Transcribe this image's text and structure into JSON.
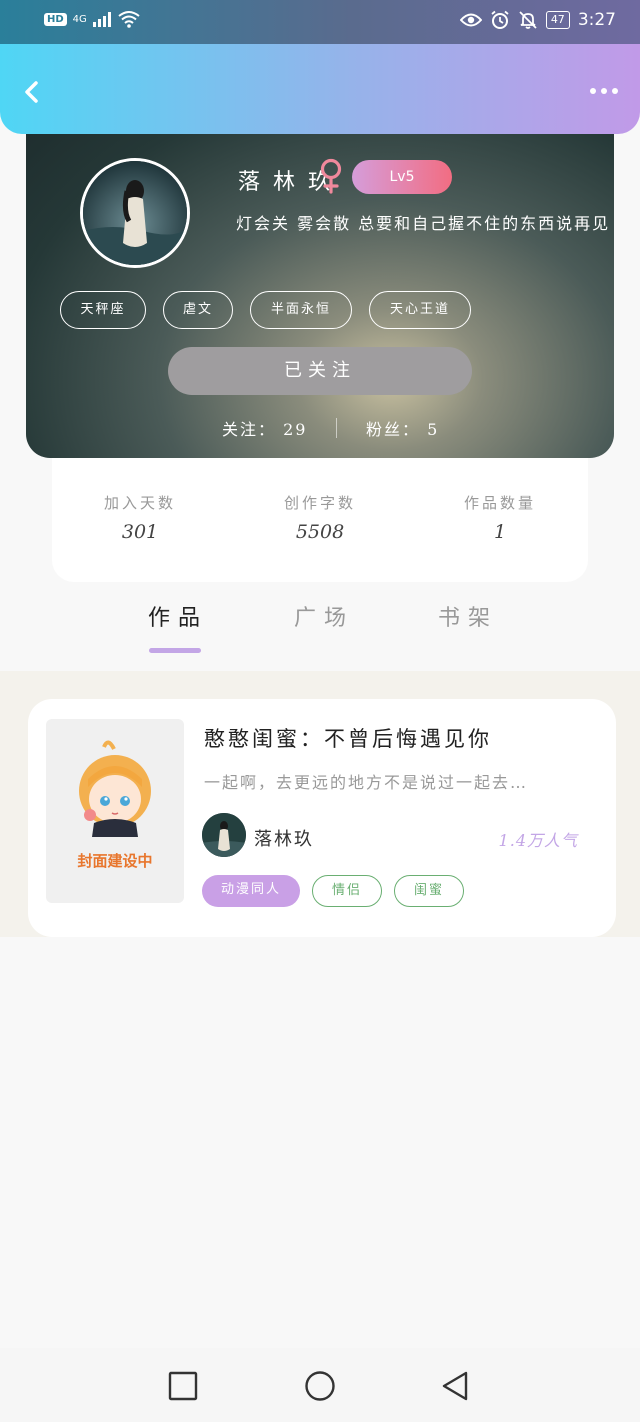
{
  "status_bar": {
    "hd": "HD",
    "network": "4G",
    "battery": "47",
    "time": "3:27",
    "icons": [
      "eye-icon",
      "alarm-icon",
      "bell-off-icon"
    ]
  },
  "header": {
    "back_icon": "chevron-left-icon",
    "more_icon": "more-dots-icon",
    "gradient": [
      "#4fd6f5",
      "#c19ae8"
    ]
  },
  "profile": {
    "name": "落 林 玖",
    "gender_icon": "female-icon",
    "level": "Lv5",
    "signature": "灯会关 雾会散 总要和自己握不住的东西说再见",
    "tags": [
      "天秤座",
      "虐文",
      "半面永恒",
      "天心王道"
    ],
    "follow_button": "已关注",
    "following": "关注： 29",
    "fans": "粉丝： 5"
  },
  "stats": [
    {
      "label": "加入天数",
      "value": "301"
    },
    {
      "label": "创作字数",
      "value": "5508"
    },
    {
      "label": "作品数量",
      "value": "1"
    }
  ],
  "tabs": [
    {
      "label": "作品",
      "active": true
    },
    {
      "label": "广场",
      "active": false
    },
    {
      "label": "书架",
      "active": false
    }
  ],
  "work": {
    "cover_text": "封面建设中",
    "title": "憨憨闺蜜：不曾后悔遇见你",
    "description": "一起啊，去更远的地方不是说过一起去…",
    "author": "落林玖",
    "popularity": "1.4万人气",
    "tags": [
      "动漫同人",
      "情侣",
      "闺蜜"
    ]
  },
  "navbar": {
    "icons": [
      "recent-apps-icon",
      "home-icon",
      "back-triangle-icon"
    ]
  },
  "colors": {
    "accent_purple": "#c3a6e6",
    "tag_green": "#6aaf72",
    "level_gradient": [
      "#d59dda",
      "#f26d82"
    ]
  }
}
